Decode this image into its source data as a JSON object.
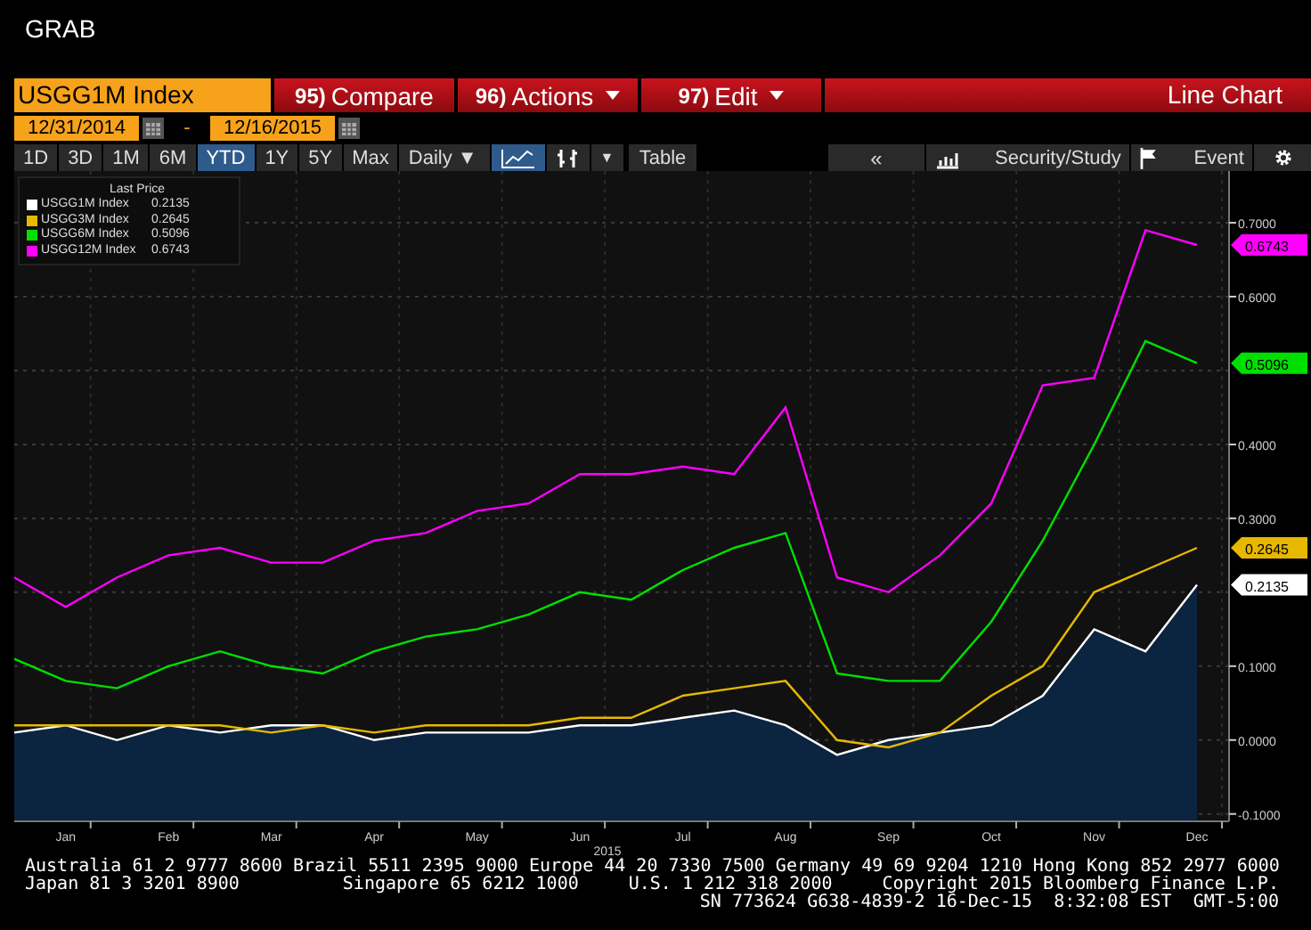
{
  "window": {
    "title": "GRAB"
  },
  "security": {
    "value": "USGG1M Index"
  },
  "menu": [
    {
      "number": "95)",
      "label": "Compare",
      "dropdown": false
    },
    {
      "number": "96)",
      "label": "Actions",
      "dropdown": true
    },
    {
      "number": "97)",
      "label": "Edit",
      "dropdown": true
    }
  ],
  "view_title": "Line Chart",
  "date_range": {
    "start": "12/31/2014",
    "separator": "-",
    "end": "12/16/2015"
  },
  "periods": [
    {
      "label": "1D",
      "selected": false
    },
    {
      "label": "3D",
      "selected": false
    },
    {
      "label": "1M",
      "selected": false
    },
    {
      "label": "6M",
      "selected": false
    },
    {
      "label": "YTD",
      "selected": true
    },
    {
      "label": "1Y",
      "selected": false
    },
    {
      "label": "5Y",
      "selected": false
    },
    {
      "label": "Max",
      "selected": false
    }
  ],
  "frequency": {
    "label": "Daily",
    "caret": "▼"
  },
  "chart_tools": {
    "caret": "▼",
    "table": "Table",
    "back": "«",
    "study": "Security/Study",
    "event": "Event"
  },
  "legend": {
    "title": "Last Price",
    "values": [
      "0.2135",
      "0.2645",
      "0.5096",
      "0.6743"
    ]
  },
  "price_tags": [
    {
      "value": "0.6743",
      "color": "#ff00ff"
    },
    {
      "value": "0.5096",
      "color": "#00e000"
    },
    {
      "value": "0.2645",
      "color": "#e6b800"
    },
    {
      "value": "0.2135",
      "color": "#ffffff"
    }
  ],
  "chart_data": {
    "type": "line",
    "xlabel": "2015",
    "grid": true,
    "legend": true,
    "categories": [
      null,
      "Jan",
      null,
      "Feb",
      null,
      "Mar",
      null,
      "Apr",
      null,
      "May",
      null,
      "Jun",
      null,
      "Jul",
      null,
      "Aug",
      null,
      "Sep",
      null,
      "Oct",
      null,
      "Nov",
      null,
      "Dec"
    ],
    "ylim": [
      -0.11,
      0.77
    ],
    "yticks": [
      {
        "value": -0.1,
        "label": "-0.1000"
      },
      {
        "value": 0,
        "label": "0.0000"
      },
      {
        "value": 0.1,
        "label": "0.1000"
      },
      {
        "value": 0.3,
        "label": "0.3000"
      },
      {
        "value": 0.4,
        "label": "0.4000"
      },
      {
        "value": 0.6,
        "label": "0.6000"
      },
      {
        "value": 0.7,
        "label": "0.7000"
      }
    ],
    "series": [
      {
        "name": "USGG1M Index",
        "color": "#ffffff",
        "values": [
          0.01,
          0.02,
          0.0,
          0.02,
          0.01,
          0.02,
          0.02,
          0.0,
          0.01,
          0.01,
          0.01,
          0.02,
          0.02,
          0.03,
          0.04,
          0.02,
          -0.02,
          0.0,
          0.01,
          0.02,
          0.06,
          0.15,
          0.12,
          0.21
        ]
      },
      {
        "name": "USGG3M Index",
        "color": "#e6b800",
        "values": [
          0.02,
          0.02,
          0.02,
          0.02,
          0.02,
          0.01,
          0.02,
          0.01,
          0.02,
          0.02,
          0.02,
          0.03,
          0.03,
          0.06,
          0.07,
          0.08,
          0.0,
          -0.01,
          0.01,
          0.06,
          0.1,
          0.2,
          0.23,
          0.26
        ]
      },
      {
        "name": "USGG6M Index",
        "color": "#00e000",
        "values": [
          0.11,
          0.08,
          0.07,
          0.1,
          0.12,
          0.1,
          0.09,
          0.12,
          0.14,
          0.15,
          0.17,
          0.2,
          0.19,
          0.23,
          0.26,
          0.28,
          0.09,
          0.08,
          0.08,
          0.16,
          0.27,
          0.4,
          0.54,
          0.51
        ]
      },
      {
        "name": "USGG12M Index",
        "color": "#ff00ff",
        "values": [
          0.22,
          0.18,
          0.22,
          0.25,
          0.26,
          0.24,
          0.24,
          0.27,
          0.28,
          0.31,
          0.32,
          0.36,
          0.36,
          0.37,
          0.36,
          0.45,
          0.22,
          0.2,
          0.25,
          0.32,
          0.48,
          0.49,
          0.69,
          0.67
        ]
      }
    ]
  },
  "footer": {
    "lines": [
      [
        "Australia 61 2 9777 8600 Brazil 5511 2395 9000 Europe 44 20 7330 7500 Germany 49 69 9204 1210 Hong Kong 852 2977 6000"
      ],
      [
        "Japan 81 3 3201 8900",
        "Singapore 65 6212 1000",
        "U.S. 1 212 318 2000",
        "Copyright 2015 Bloomberg Finance L.P."
      ],
      [
        "SN 773624 G638-4839-2 16-Dec-15  8:32:08 EST  GMT-5:00"
      ]
    ]
  }
}
